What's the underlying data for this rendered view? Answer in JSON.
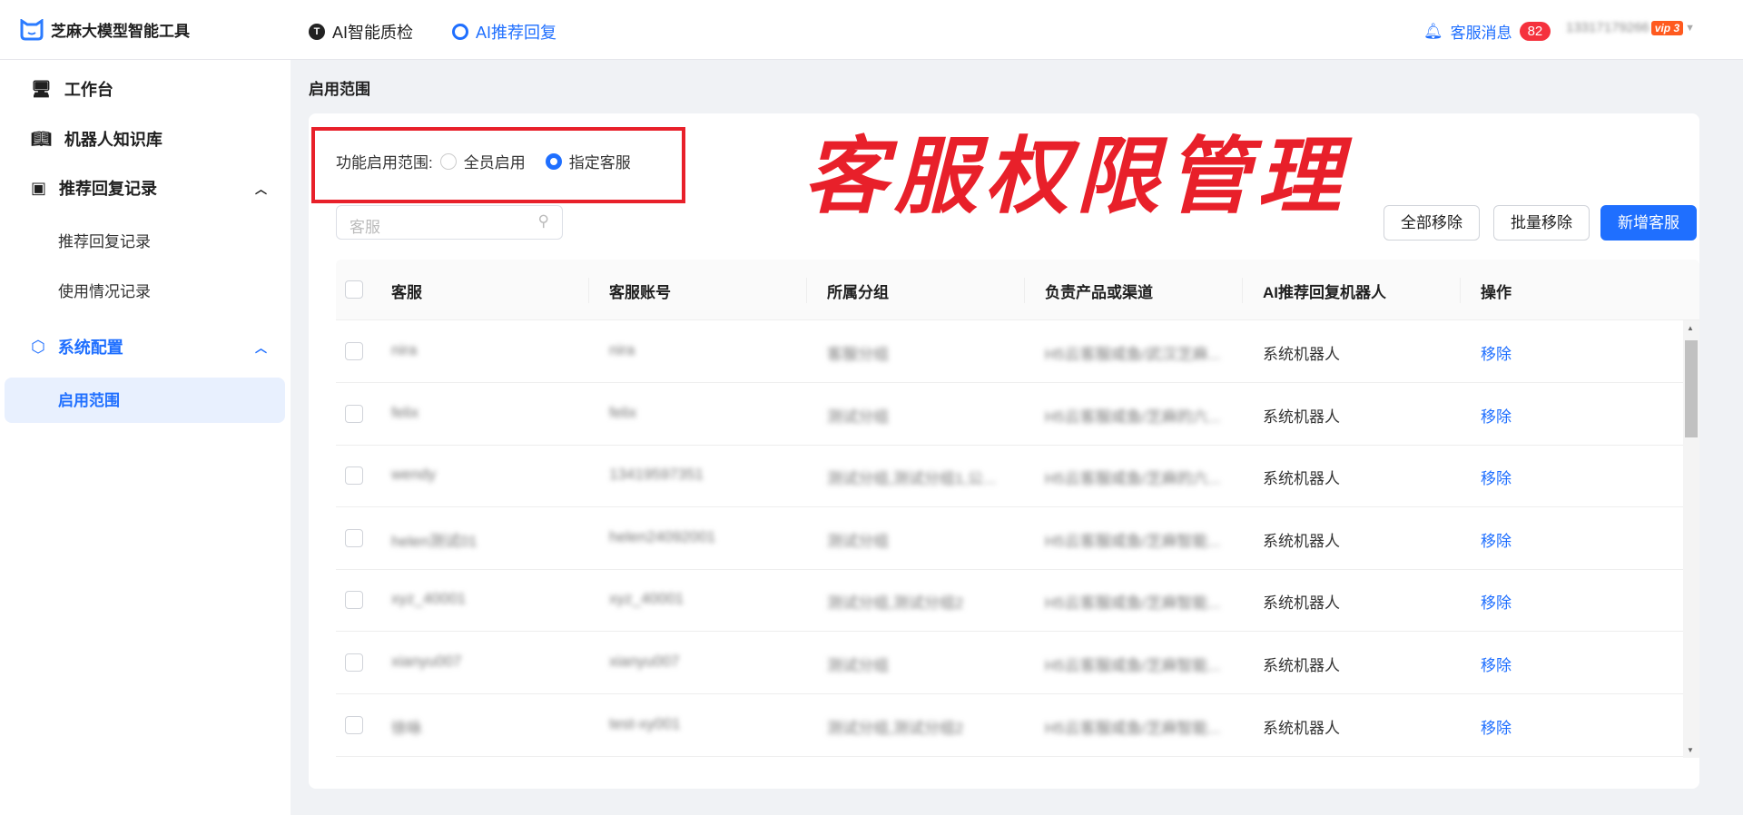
{
  "header": {
    "app_name": "芝麻大模型智能工具",
    "nav": [
      {
        "label": "AI智能质检",
        "icon": "quality-icon"
      },
      {
        "label": "AI推荐回复",
        "icon": "bot-icon",
        "active": true
      }
    ],
    "messages_label": "客服消息",
    "messages_count": "82",
    "account": "13317179266",
    "vip": "vip",
    "vip_level": "3"
  },
  "sidebar": {
    "items": [
      {
        "label": "工作台",
        "icon": "monitor-icon"
      },
      {
        "label": "机器人知识库",
        "icon": "book-icon"
      },
      {
        "label": "推荐回复记录",
        "icon": "record-icon",
        "expanded": true,
        "children": [
          "推荐回复记录",
          "使用情况记录"
        ]
      },
      {
        "label": "系统配置",
        "icon": "settings-icon",
        "expanded": true,
        "active": true,
        "children": [
          "启用范围"
        ]
      }
    ]
  },
  "page": {
    "breadcrumb": "启用范围",
    "scope_label": "功能启用范围:",
    "scope_options": [
      "全员启用",
      "指定客服"
    ],
    "scope_selected": "指定客服",
    "annotation": "客服权限管理",
    "search_placeholder": "客服",
    "buttons": {
      "remove_all": "全部移除",
      "batch_remove": "批量移除",
      "add": "新增客服"
    }
  },
  "table": {
    "columns": [
      "客服",
      "客服账号",
      "所属分组",
      "负责产品或渠道",
      "AI推荐回复机器人",
      "操作"
    ],
    "rows": [
      [
        "nira",
        "nira",
        "客服分组",
        "H5云客服咸鱼/武汉芝麻...",
        "系统机器人",
        "移除"
      ],
      [
        "felix",
        "felix",
        "测试分组",
        "H5云客服咸鱼/芝麻的六...",
        "系统机器人",
        "移除"
      ],
      [
        "wendy",
        "13419597351",
        "测试分组,测试分组1,公...",
        "H5云客服咸鱼/芝麻的六...",
        "系统机器人",
        "移除"
      ],
      [
        "helen测试01",
        "helen24092001",
        "测试分组",
        "H5云客服咸鱼/芝麻智能...",
        "系统机器人",
        "移除"
      ],
      [
        "xyz_40001",
        "xyz_40001",
        "测试分组,测试分组2",
        "H5云客服咸鱼/芝麻智能...",
        "系统机器人",
        "移除"
      ],
      [
        "xianyu007",
        "xianyu007",
        "测试分组",
        "H5云客服咸鱼/芝麻智能...",
        "系统机器人",
        "移除"
      ],
      [
        "徐咏",
        "test-xy001",
        "测试分组,测试分组2",
        "H5云客服咸鱼/芝麻智能...",
        "系统机器人",
        "移除"
      ]
    ]
  },
  "colors": {
    "accent": "#1f6fff",
    "annotation": "#e8202a",
    "badge": "#f5313d",
    "vip": "#ff5a1f"
  }
}
